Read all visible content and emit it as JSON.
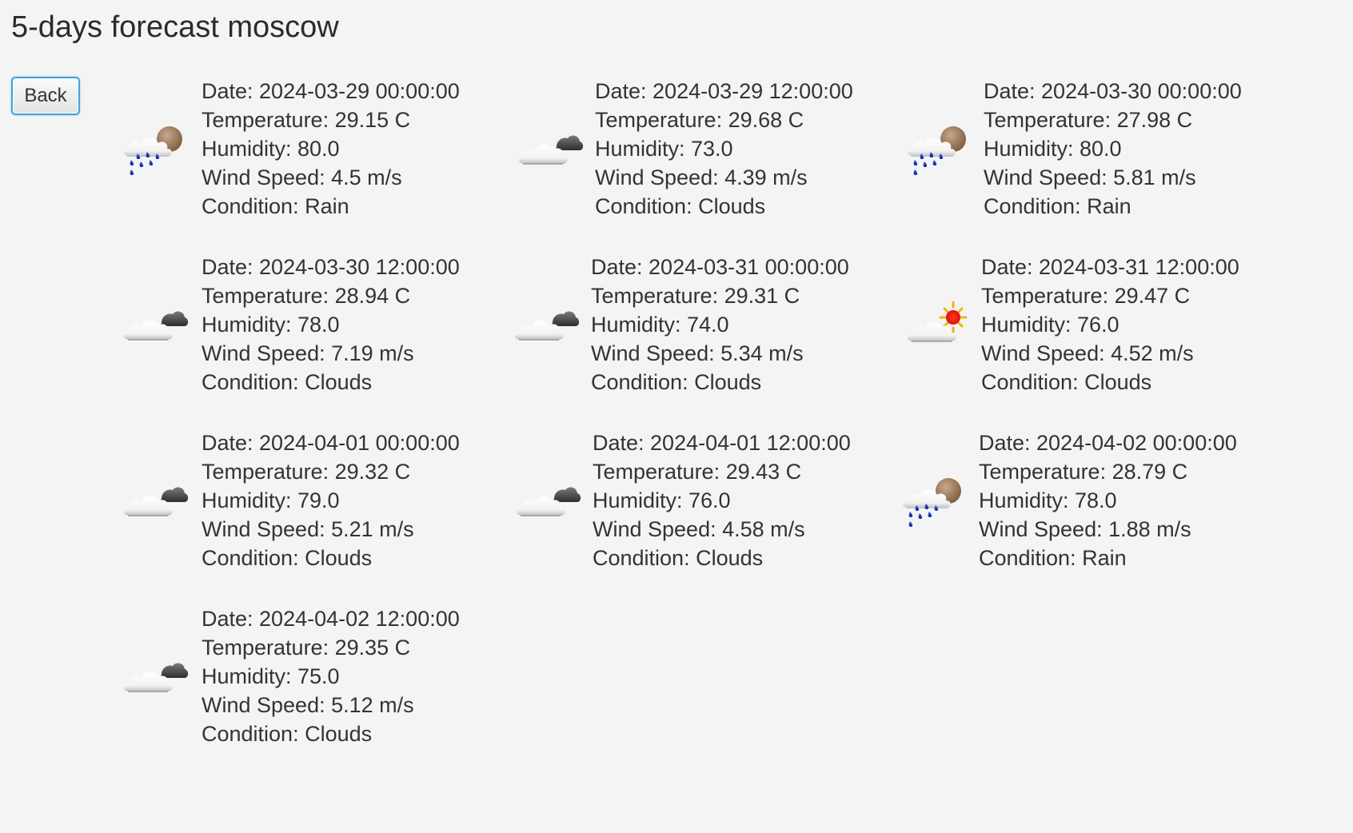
{
  "window": {
    "title": "5-days forecast moscow"
  },
  "toolbar": {
    "back_label": "Back"
  },
  "forecasts": [
    {
      "date": "Date: 2024-03-29 00:00:00",
      "temperature": "Temperature: 29.15 C",
      "humidity": "Humidity: 80.0",
      "wind": "Wind Speed: 4.5 m/s",
      "condition": "Condition: Rain",
      "icon": "rain-icon"
    },
    {
      "date": "Date: 2024-03-29 12:00:00",
      "temperature": "Temperature: 29.68 C",
      "humidity": "Humidity: 73.0",
      "wind": "Wind Speed: 4.39 m/s",
      "condition": "Condition: Clouds",
      "icon": "broken-clouds-icon"
    },
    {
      "date": "Date: 2024-03-30 00:00:00",
      "temperature": "Temperature: 27.98 C",
      "humidity": "Humidity: 80.0",
      "wind": "Wind Speed: 5.81 m/s",
      "condition": "Condition: Rain",
      "icon": "rain-icon"
    },
    {
      "date": "Date: 2024-03-30 12:00:00",
      "temperature": "Temperature: 28.94 C",
      "humidity": "Humidity: 78.0",
      "wind": "Wind Speed: 7.19 m/s",
      "condition": "Condition: Clouds",
      "icon": "broken-clouds-icon"
    },
    {
      "date": "Date: 2024-03-31 00:00:00",
      "temperature": "Temperature: 29.31 C",
      "humidity": "Humidity: 74.0",
      "wind": "Wind Speed: 5.34 m/s",
      "condition": "Condition: Clouds",
      "icon": "broken-clouds-icon"
    },
    {
      "date": "Date: 2024-03-31 12:00:00",
      "temperature": "Temperature: 29.47 C",
      "humidity": "Humidity: 76.0",
      "wind": "Wind Speed: 4.52 m/s",
      "condition": "Condition: Clouds",
      "icon": "partly-sunny-icon"
    },
    {
      "date": "Date: 2024-04-01 00:00:00",
      "temperature": "Temperature: 29.32 C",
      "humidity": "Humidity: 79.0",
      "wind": "Wind Speed: 5.21 m/s",
      "condition": "Condition: Clouds",
      "icon": "broken-clouds-icon"
    },
    {
      "date": "Date: 2024-04-01 12:00:00",
      "temperature": "Temperature: 29.43 C",
      "humidity": "Humidity: 76.0",
      "wind": "Wind Speed: 4.58 m/s",
      "condition": "Condition: Clouds",
      "icon": "broken-clouds-icon"
    },
    {
      "date": "Date: 2024-04-02 00:00:00",
      "temperature": "Temperature: 28.79 C",
      "humidity": "Humidity: 78.0",
      "wind": "Wind Speed: 1.88 m/s",
      "condition": "Condition: Rain",
      "icon": "rain-icon"
    },
    {
      "date": "Date: 2024-04-02 12:00:00",
      "temperature": "Temperature: 29.35 C",
      "humidity": "Humidity: 75.0",
      "wind": "Wind Speed: 5.12 m/s",
      "condition": "Condition: Clouds",
      "icon": "broken-clouds-icon"
    }
  ]
}
